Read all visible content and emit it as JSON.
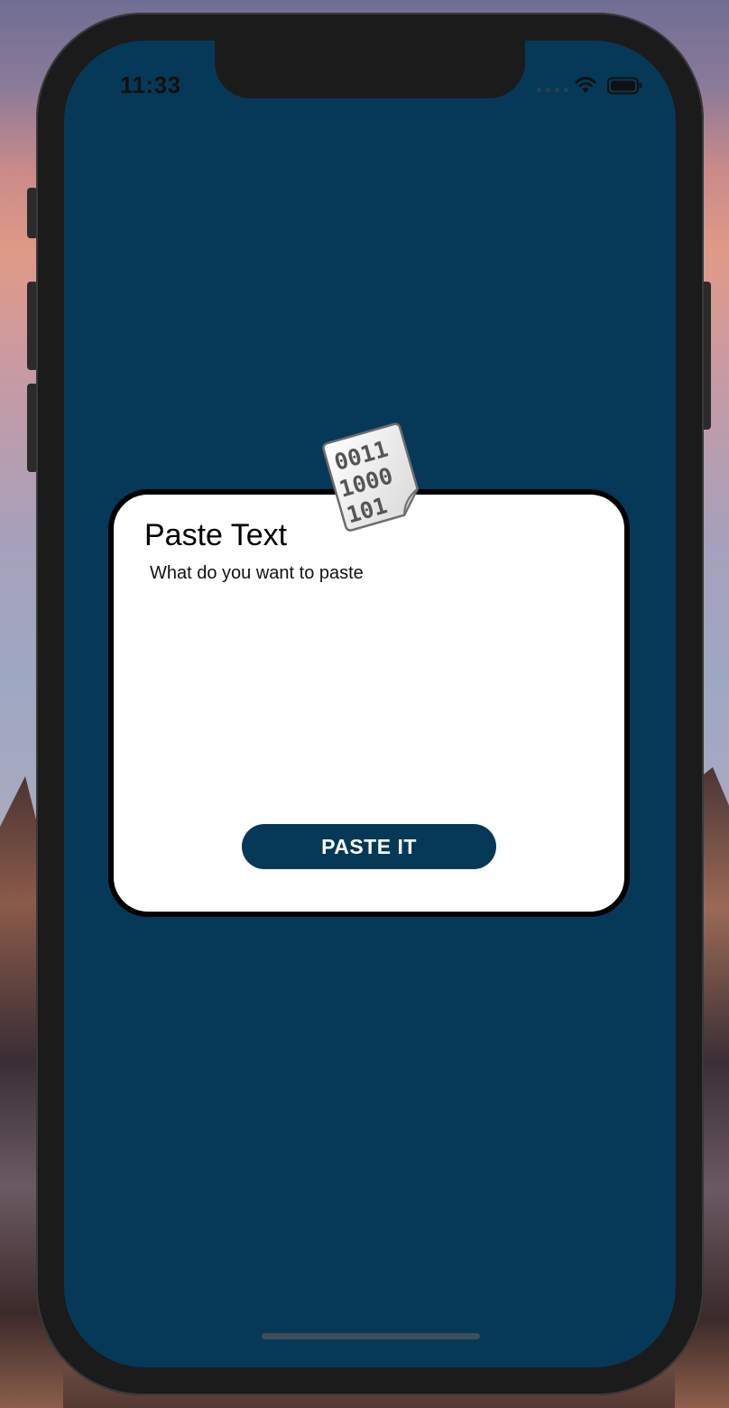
{
  "status_bar": {
    "time": "11:33",
    "icons": [
      "cellular-signal-icon",
      "wifi-icon",
      "battery-icon"
    ]
  },
  "dialog": {
    "title": "Paste Text",
    "input_placeholder": "What do you want to paste",
    "input_value": "",
    "button_label": "PASTE IT",
    "icon": "binary-file-icon",
    "icon_text": [
      "0011",
      "1000",
      "101"
    ]
  },
  "colors": {
    "screen_background": "#063957",
    "button_background": "#063957",
    "card_background": "#ffffff",
    "card_border": "#000000"
  }
}
